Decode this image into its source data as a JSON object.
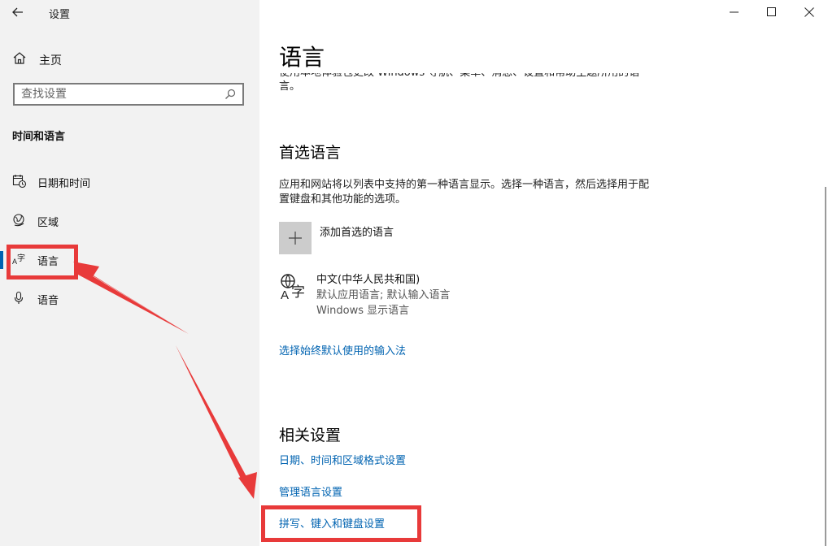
{
  "window": {
    "app_title": "设置",
    "controls": {
      "minimize": "—",
      "maximize": "☐",
      "close": "✕"
    }
  },
  "sidebar": {
    "home_label": "主页",
    "search_placeholder": "查找设置",
    "section_title": "时间和语言",
    "items": [
      {
        "label": "日期和时间",
        "icon": "calendar-clock-icon"
      },
      {
        "label": "区域",
        "icon": "globe-region-icon"
      },
      {
        "label": "语言",
        "icon": "language-icon",
        "selected": true
      },
      {
        "label": "语音",
        "icon": "microphone-icon"
      }
    ]
  },
  "main": {
    "page_title": "语言",
    "intro": "使用本地体验包更改 Windows 导航、菜单、消息、设置和帮助主题所用的语言。",
    "preferred": {
      "heading": "首选语言",
      "description": "应用和网站将以列表中支持的第一种语言显示。选择一种语言，然后选择用于配置键盘和其他功能的选项。",
      "add_label": "添加首选的语言",
      "language": {
        "name": "中文(中华人民共和国)",
        "sub1": "默认应用语言; 默认输入语言",
        "sub2": "Windows 显示语言"
      },
      "input_link": "选择始终默认使用的输入法"
    },
    "related": {
      "heading": "相关设置",
      "links": [
        "日期、时间和区域格式设置",
        "管理语言设置",
        "拼写、键入和键盘设置"
      ]
    }
  },
  "colors": {
    "accent": "#0063b1",
    "annotation": "#e83a3a",
    "sidebar_bg": "#f2f2f2"
  }
}
